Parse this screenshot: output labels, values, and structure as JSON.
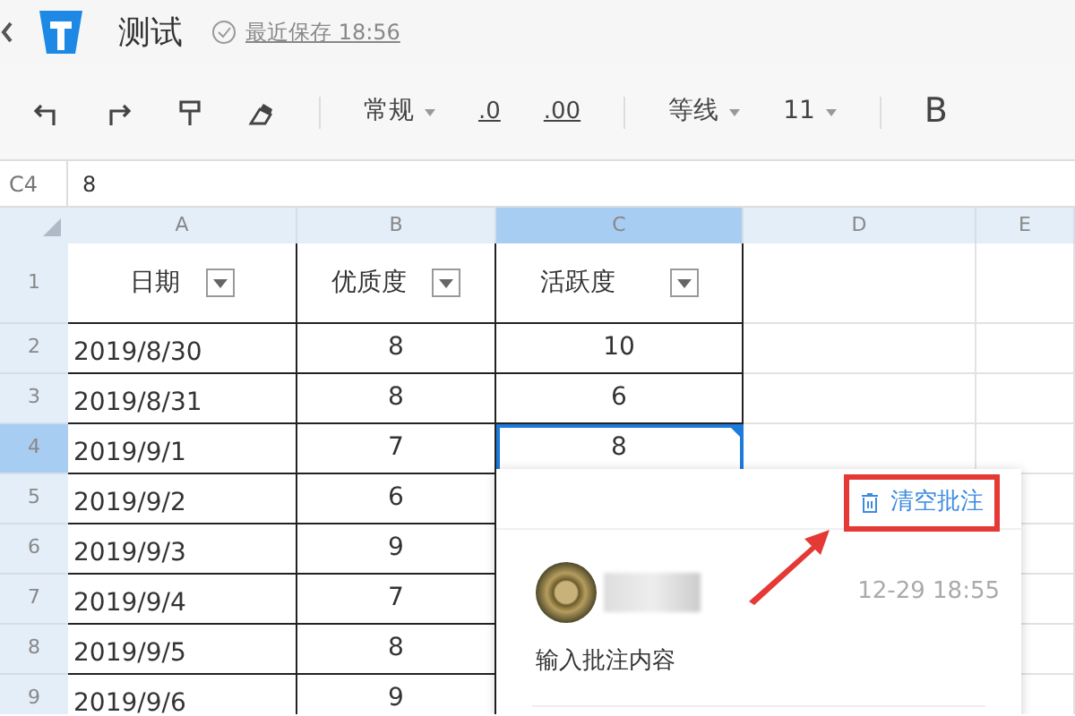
{
  "header": {
    "title": "测试",
    "save_status": "最近保存 18:56"
  },
  "toolbar": [
    {
      "kind": "undo"
    },
    {
      "kind": "redo"
    },
    {
      "kind": "painter"
    },
    {
      "kind": "eraser"
    },
    {
      "kind": "divider"
    },
    {
      "kind": "dropdown",
      "label": "常规"
    },
    {
      "kind": "decimal",
      "label": ".0"
    },
    {
      "kind": "decimal",
      "label": ".00"
    },
    {
      "kind": "divider"
    },
    {
      "kind": "dropdown",
      "label": "等线"
    },
    {
      "kind": "dropdown",
      "label": "11"
    },
    {
      "kind": "divider"
    },
    {
      "kind": "bold",
      "label": "B"
    }
  ],
  "formula_bar": {
    "cell": "C4",
    "value": "8"
  },
  "columns": [
    {
      "label": "A",
      "selected": false
    },
    {
      "label": "B",
      "selected": false
    },
    {
      "label": "C",
      "selected": true
    },
    {
      "label": "D",
      "selected": false
    },
    {
      "label": "E",
      "selected": false
    }
  ],
  "rows": [
    {
      "label": "1",
      "selected": false,
      "kind": "header",
      "cells": [
        "日期",
        "优质度",
        "活跃度"
      ]
    },
    {
      "label": "2",
      "selected": false,
      "cells": [
        "2019/8/30",
        "8",
        "10"
      ]
    },
    {
      "label": "3",
      "selected": false,
      "cells": [
        "2019/8/31",
        "8",
        "6"
      ]
    },
    {
      "label": "4",
      "selected": true,
      "cells": [
        "2019/9/1",
        "7",
        "8"
      ]
    },
    {
      "label": "5",
      "selected": false,
      "cells": [
        "2019/9/2",
        "6"
      ]
    },
    {
      "label": "6",
      "selected": false,
      "cells": [
        "2019/9/3",
        "9"
      ]
    },
    {
      "label": "7",
      "selected": false,
      "cells": [
        "2019/9/4",
        "7"
      ]
    },
    {
      "label": "8",
      "selected": false,
      "cells": [
        "2019/9/5",
        "8"
      ]
    },
    {
      "label": "9",
      "selected": false,
      "cells": [
        "2019/9/6",
        "9"
      ]
    }
  ],
  "comment_popup": {
    "clear_label": "清空批注",
    "time": "12-29 18:55",
    "placeholder": "输入批注内容"
  }
}
